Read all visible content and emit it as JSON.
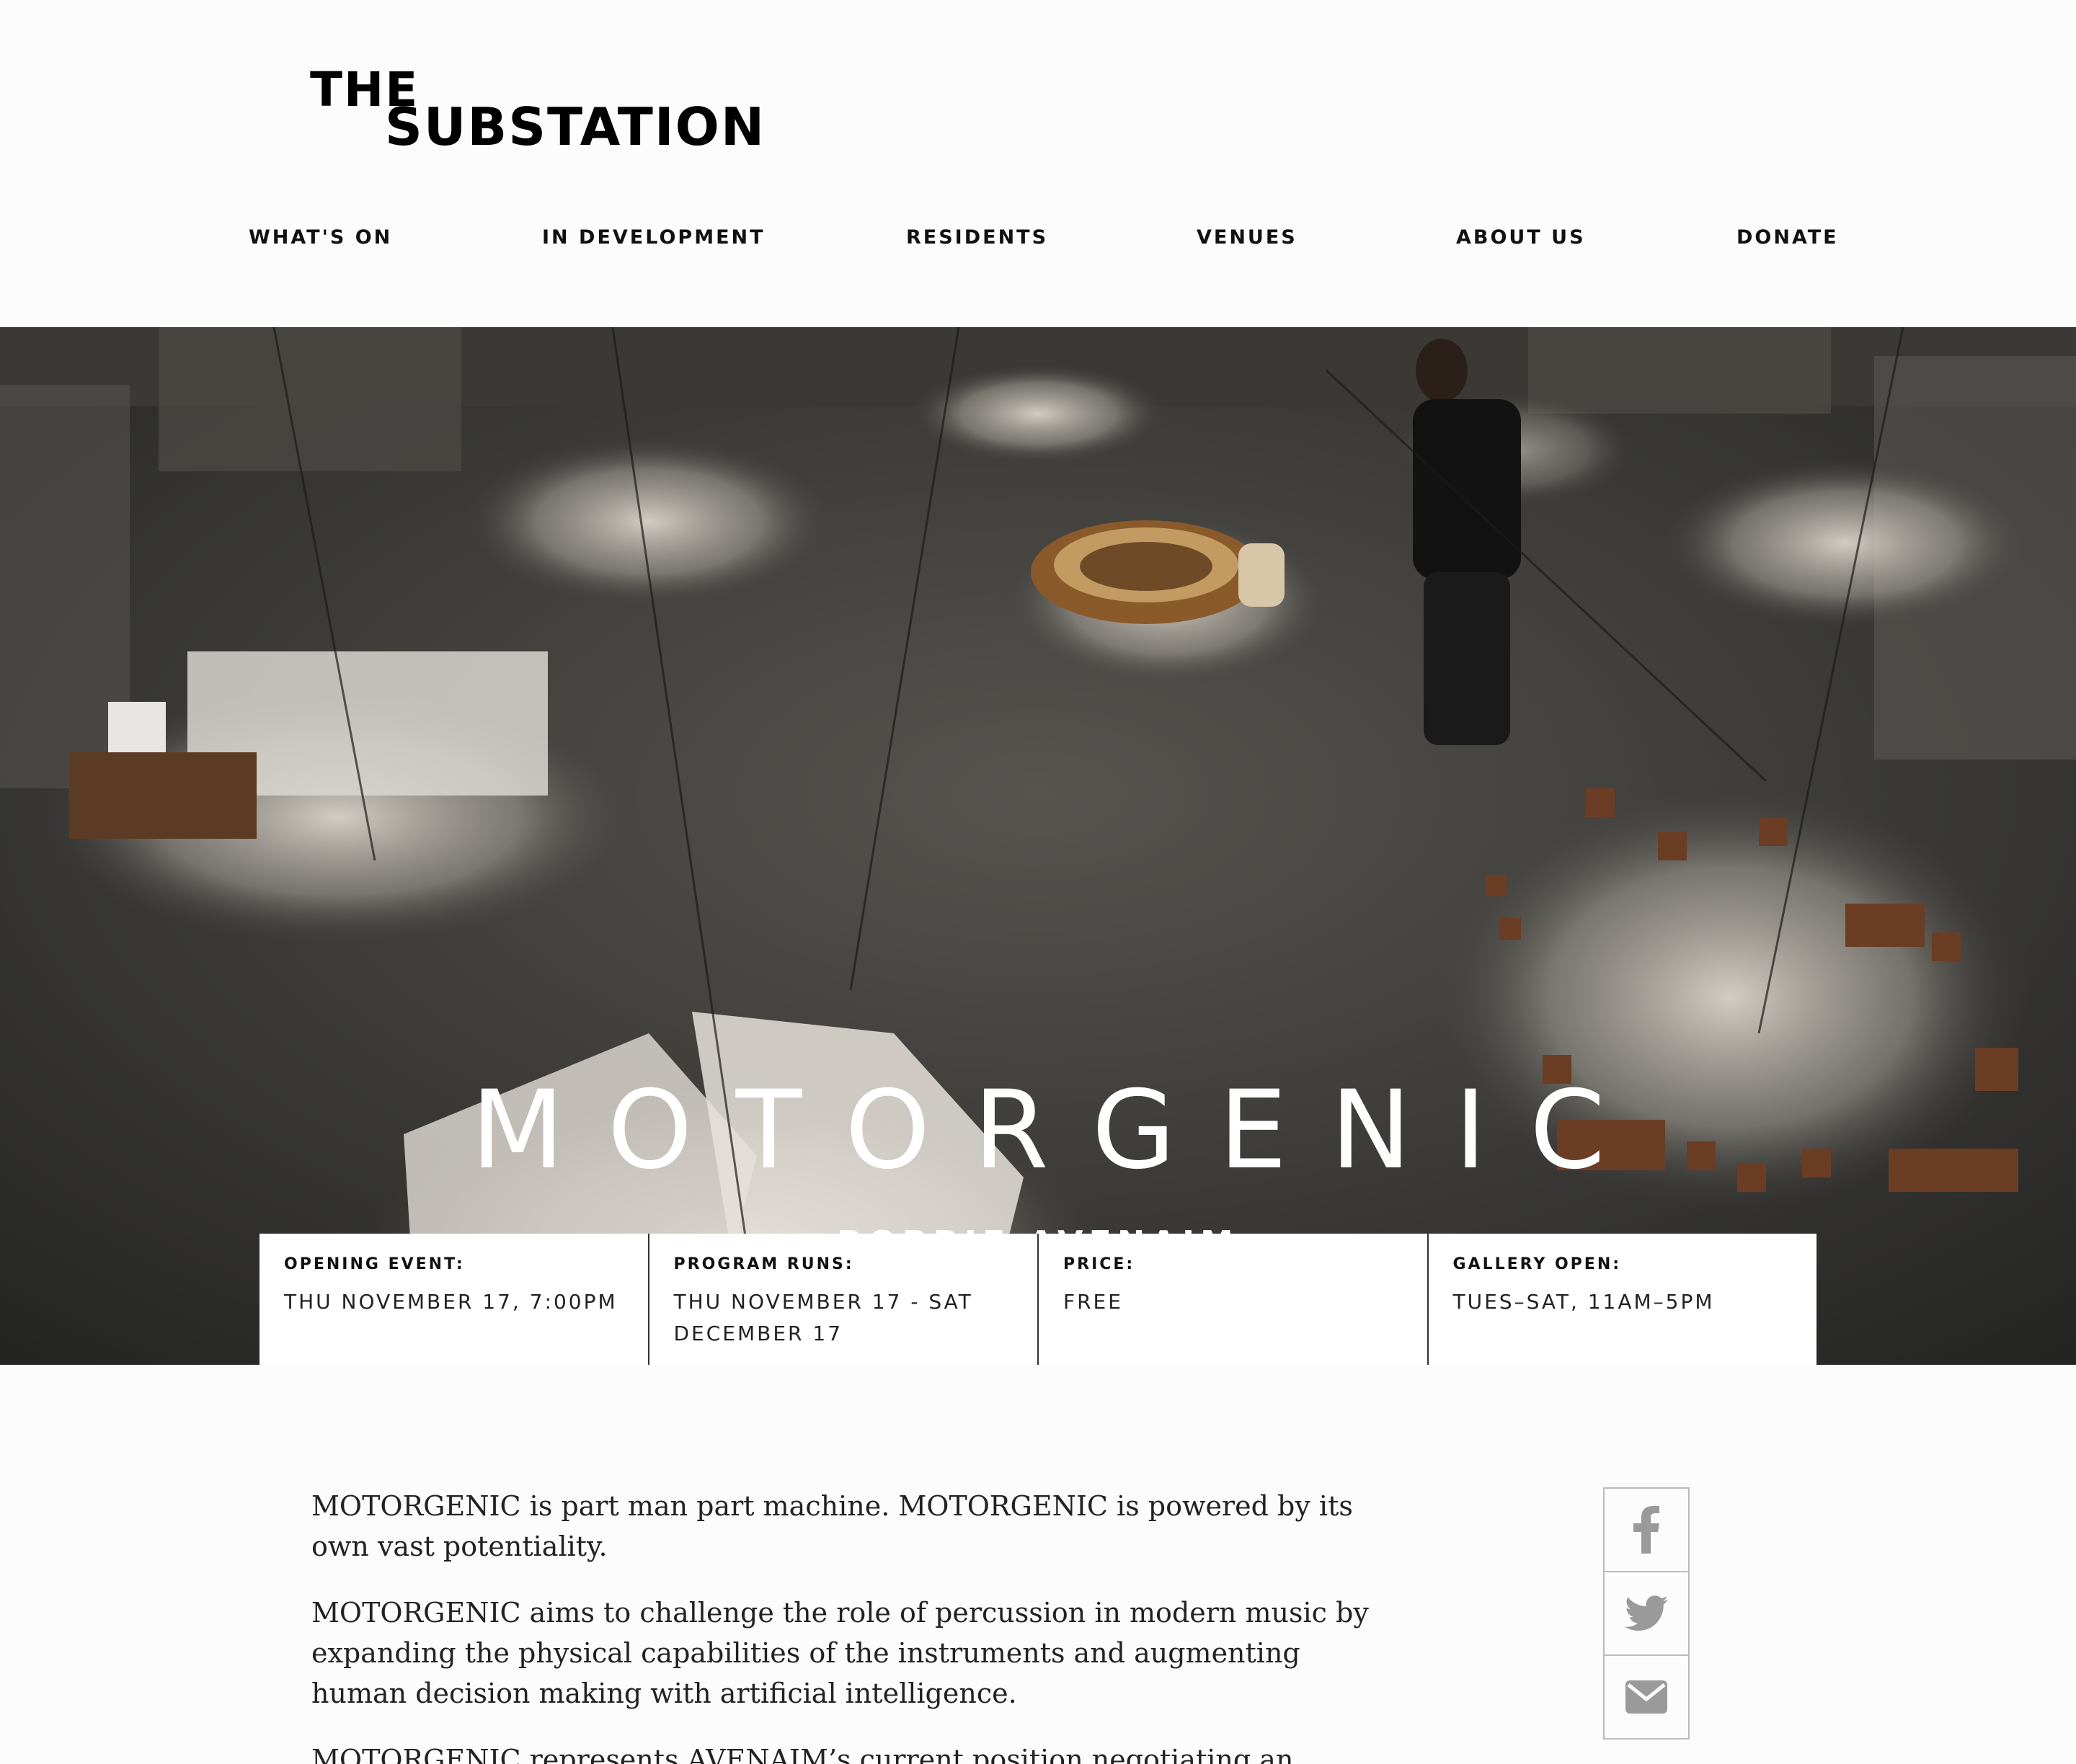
{
  "logo": {
    "line1": "THE",
    "line2": "SUBSTATION"
  },
  "nav": {
    "items": [
      {
        "label": "WHAT'S ON"
      },
      {
        "label": "IN DEVELOPMENT"
      },
      {
        "label": "RESIDENTS"
      },
      {
        "label": "VENUES"
      },
      {
        "label": "ABOUT US"
      },
      {
        "label": "DONATE"
      }
    ]
  },
  "hero": {
    "title": "MOTORGENIC",
    "artist": "ROBBIE AVENAIM"
  },
  "info": [
    {
      "label": "OPENING EVENT:",
      "value": "THU NOVEMBER 17, 7:00PM"
    },
    {
      "label": "PROGRAM RUNS:",
      "value": "THU NOVEMBER 17 - SAT DECEMBER 17"
    },
    {
      "label": "PRICE:",
      "value": "FREE"
    },
    {
      "label": "GALLERY OPEN:",
      "value": "TUES–SAT, 11AM–5PM"
    }
  ],
  "body": {
    "paragraphs": [
      "MOTORGENIC is part man part machine. MOTORGENIC is powered by its own vast potentiality.",
      "MOTORGENIC aims to challenge the role of percussion in modern music by expanding the physical capabilities of the instruments and augmenting human decision making with artificial intelligence.",
      "MOTORGENIC represents AVENAIM’s current position negotiating an ongoing loop"
    ]
  },
  "share": {
    "icons": [
      "facebook-icon",
      "twitter-icon",
      "email-icon"
    ],
    "icon_color": "#9a9a9a"
  },
  "colors": {
    "background": "#fcfcfc",
    "text": "#111111",
    "hero_text": "#ffffff"
  }
}
